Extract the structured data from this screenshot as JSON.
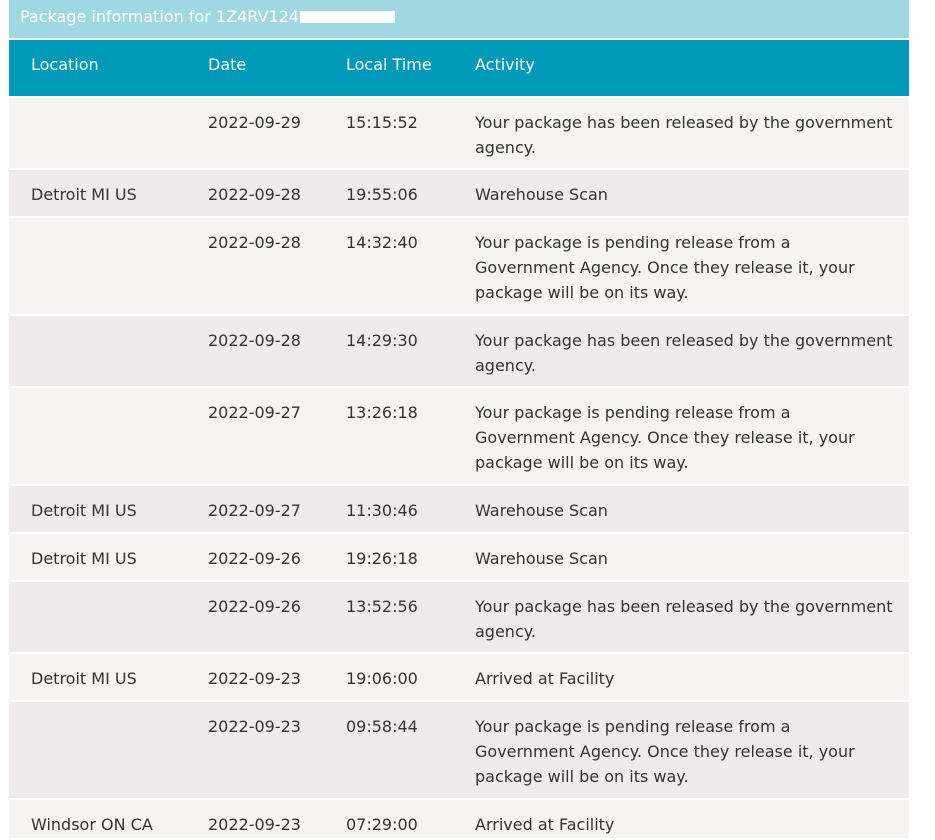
{
  "title": {
    "prefix": "Package information for",
    "tracking_visible": "1Z4RV124"
  },
  "columns": {
    "location": "Location",
    "date": "Date",
    "time": "Local Time",
    "activity": "Activity"
  },
  "rows": [
    {
      "location": "",
      "date": "2022-09-29",
      "time": "15:15:52",
      "activity": "Your package has been released by the government agency."
    },
    {
      "location": "Detroit MI US",
      "date": "2022-09-28",
      "time": "19:55:06",
      "activity": "Warehouse Scan"
    },
    {
      "location": "",
      "date": "2022-09-28",
      "time": "14:32:40",
      "activity": "Your package is pending release from a Government Agency. Once they release it, your package will be on its way."
    },
    {
      "location": "",
      "date": "2022-09-28",
      "time": "14:29:30",
      "activity": "Your package has been released by the government agency."
    },
    {
      "location": "",
      "date": "2022-09-27",
      "time": "13:26:18",
      "activity": "Your package is pending release from a Government Agency. Once they release it, your package will be on its way."
    },
    {
      "location": "Detroit MI US",
      "date": "2022-09-27",
      "time": "11:30:46",
      "activity": "Warehouse Scan"
    },
    {
      "location": "Detroit MI US",
      "date": "2022-09-26",
      "time": "19:26:18",
      "activity": "Warehouse Scan"
    },
    {
      "location": "",
      "date": "2022-09-26",
      "time": "13:52:56",
      "activity": "Your package has been released by the government agency."
    },
    {
      "location": "Detroit MI US",
      "date": "2022-09-23",
      "time": "19:06:00",
      "activity": "Arrived at Facility"
    },
    {
      "location": "",
      "date": "2022-09-23",
      "time": "09:58:44",
      "activity": "Your package is pending release from a Government Agency. Once they release it, your package will be on its way."
    },
    {
      "location": "Windsor ON CA",
      "date": "2022-09-23",
      "time": "07:29:00",
      "activity": "Arrived at Facility"
    }
  ]
}
